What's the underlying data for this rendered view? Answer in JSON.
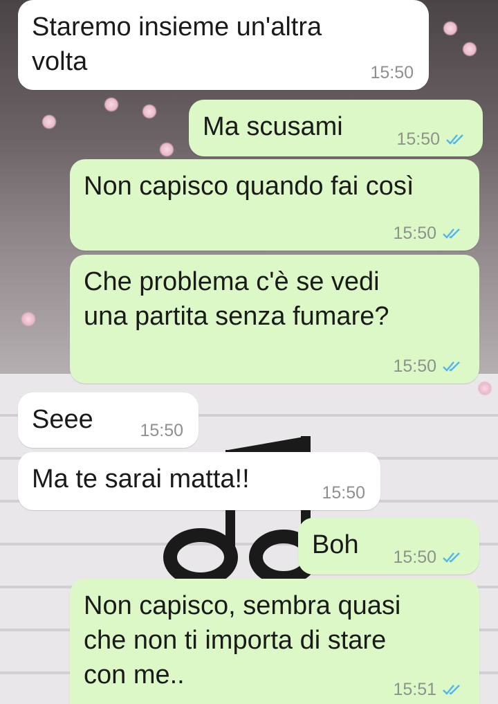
{
  "colors": {
    "incoming_bubble": "#ffffff",
    "outgoing_bubble": "#dcf8c6",
    "read_tick": "#4fb6ec",
    "timestamp": "#8c938b"
  },
  "icons": {
    "read_receipt": "double-check-icon"
  },
  "messages": [
    {
      "direction": "incoming",
      "text": "Staremo insieme un'altra\nvolta",
      "time": "15:50"
    },
    {
      "direction": "outgoing",
      "text": "Ma scusami",
      "time": "15:50",
      "status": "read"
    },
    {
      "direction": "outgoing",
      "text": "Non capisco quando fai così",
      "time": "15:50",
      "status": "read"
    },
    {
      "direction": "outgoing",
      "text": "Che problema c'è se vedi\nuna partita senza fumare?",
      "time": "15:50",
      "status": "read"
    },
    {
      "direction": "incoming",
      "text": "Seee",
      "time": "15:50"
    },
    {
      "direction": "incoming",
      "text": "Ma te sarai matta!!",
      "time": "15:50"
    },
    {
      "direction": "outgoing",
      "text": "Boh",
      "time": "15:50",
      "status": "read"
    },
    {
      "direction": "outgoing",
      "text": "Non capisco, sembra quasi\nche non ti importa di stare\ncon me..",
      "time": "15:51",
      "status": "read"
    }
  ]
}
